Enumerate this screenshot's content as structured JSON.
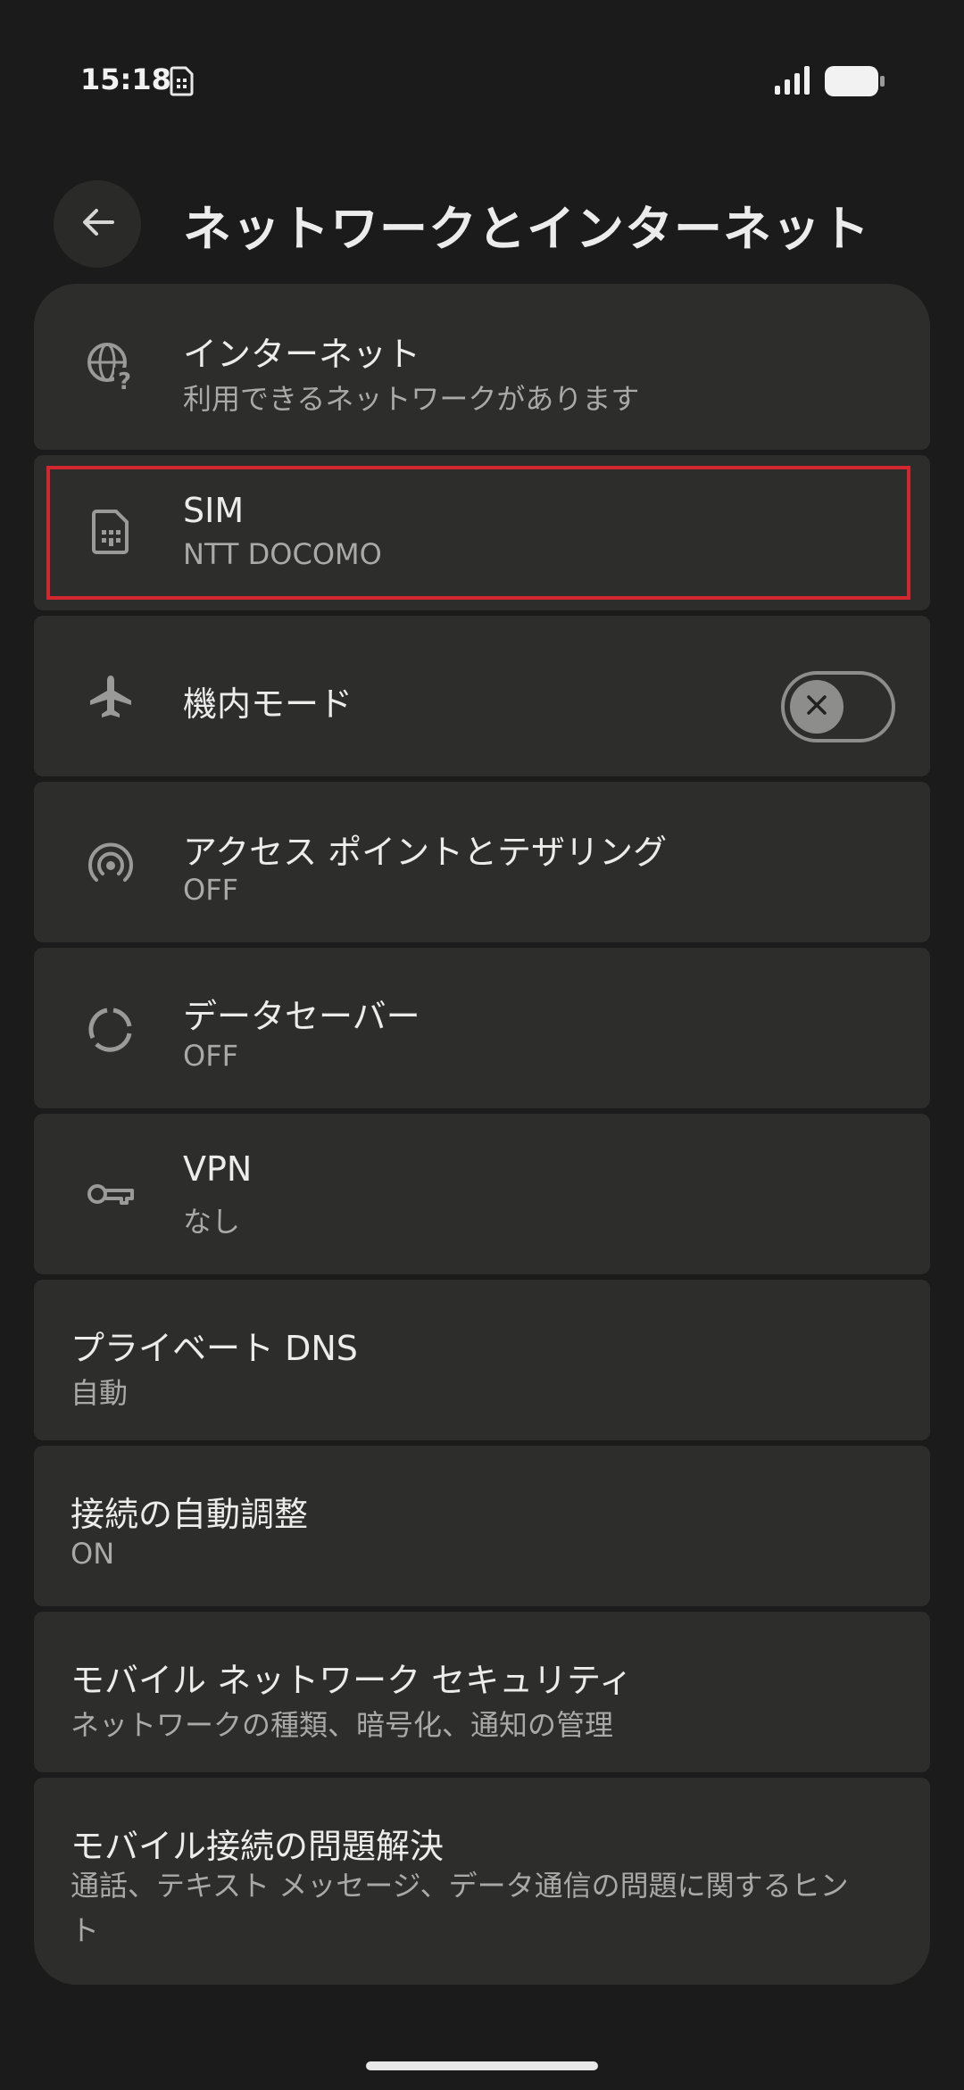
{
  "status_bar": {
    "time": "15:18",
    "icons": [
      "sim-card-icon",
      "signal-icon",
      "battery-icon"
    ]
  },
  "header": {
    "title": "ネットワークとインターネット",
    "back_icon": "arrow-back-icon"
  },
  "colors": {
    "background": "#1b1b1b",
    "card": "#2d2e2c",
    "highlight": "#d4262e",
    "text_primary": "#ececec",
    "text_secondary": "#a9aaa7"
  },
  "items": [
    {
      "title": "インターネット",
      "subtitle": "利用できるネットワークがあります",
      "icon": "globe-question-icon"
    },
    {
      "title": "SIM",
      "subtitle": "NTT DOCOMO",
      "icon": "sim-card-icon"
    },
    {
      "title": "機内モード",
      "icon": "airplane-icon",
      "toggle": "off"
    },
    {
      "title": "アクセス ポイントとテザリング",
      "subtitle": "OFF",
      "icon": "hotspot-icon"
    },
    {
      "title": "データセーバー",
      "subtitle": "OFF",
      "icon": "data-saver-icon"
    },
    {
      "title": "VPN",
      "subtitle": "なし",
      "icon": "vpn-key-icon"
    },
    {
      "title": "プライベート DNS",
      "subtitle": "自動"
    },
    {
      "title": "接続の自動調整",
      "subtitle": "ON"
    },
    {
      "title": "モバイル ネットワーク セキュリティ",
      "subtitle": "ネットワークの種類、暗号化、通知の管理"
    },
    {
      "title": "モバイル接続の問題解決",
      "subtitle": "通話、テキスト メッセージ、データ通信の問題に関するヒント"
    }
  ]
}
